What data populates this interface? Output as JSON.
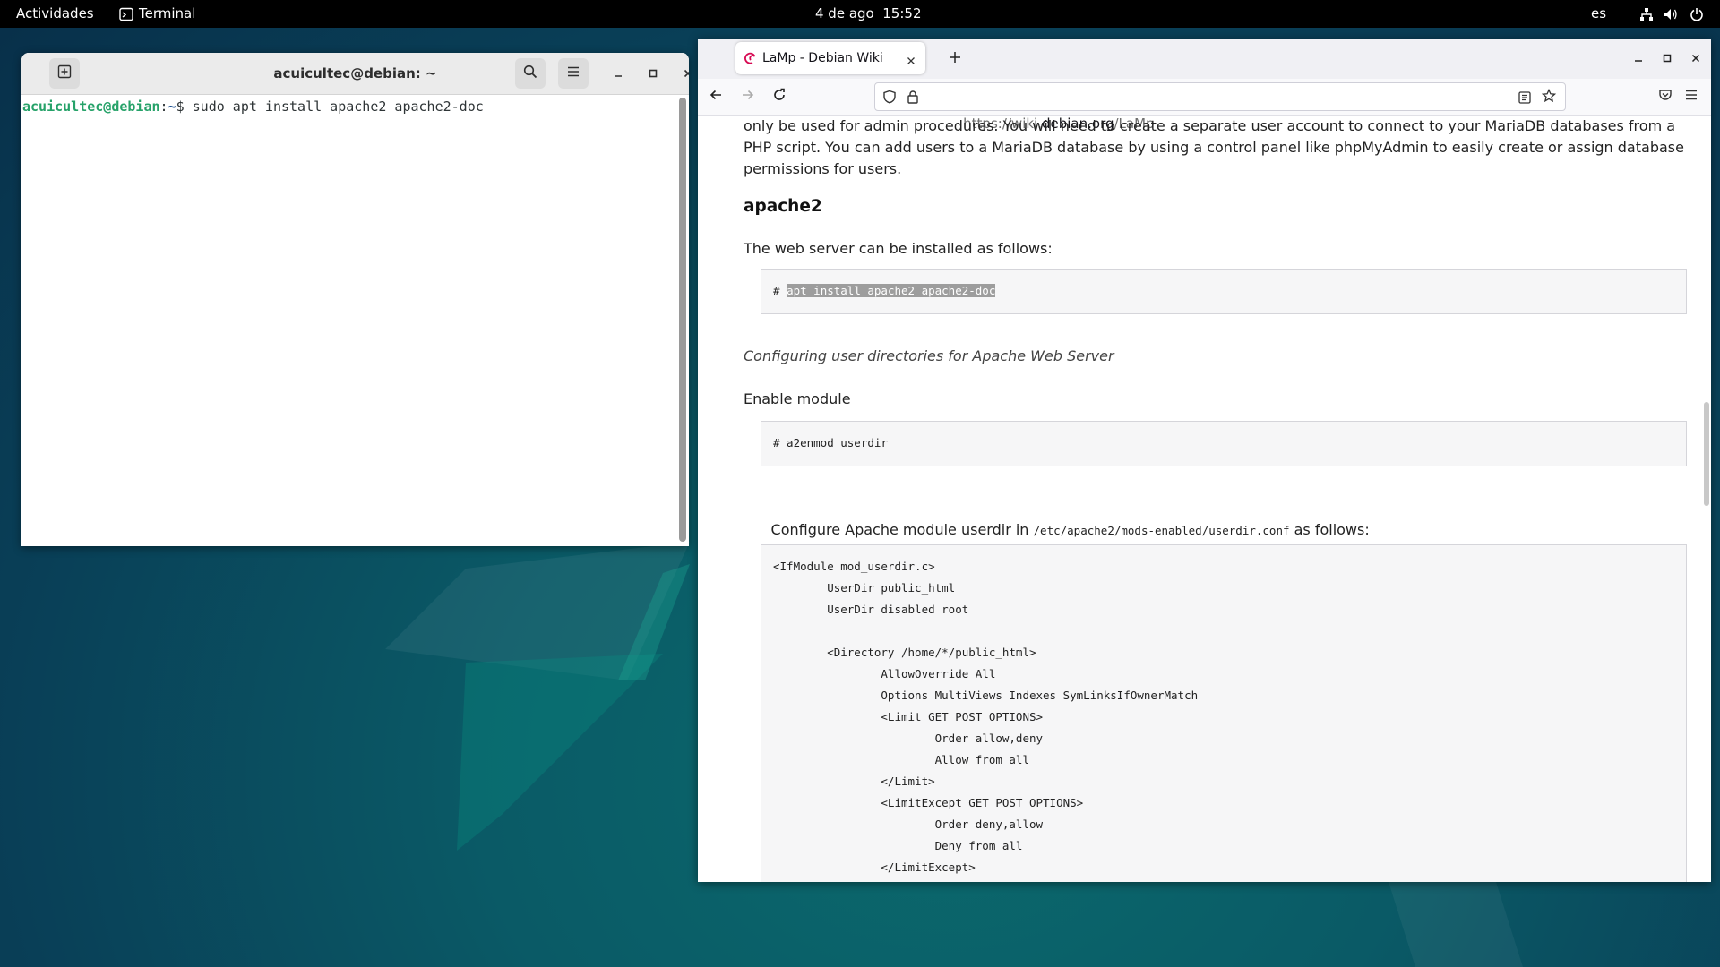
{
  "topbar": {
    "activities": "Actividades",
    "app_name": "Terminal",
    "clock": "4 de ago  15:52",
    "keyboard_layout": "es",
    "icons": [
      "network-icon",
      "volume-icon",
      "power-icon"
    ]
  },
  "terminal": {
    "title": "acuicultec@debian: ~",
    "prompt_user": "acuicultec@debian",
    "prompt_sep": ":",
    "prompt_path": "~",
    "prompt_symbol": "$",
    "command": " sudo apt install apache2 apache2-doc"
  },
  "browser": {
    "tab_title": "LaMp - Debian Wiki",
    "url_prefix": "https://wiki.",
    "url_domain": "debian.org",
    "url_path": "/LaMp",
    "content": {
      "intro_line1": "only be used for admin procedures. You will need to create a separate user account to connect to your MariaDB databases from a",
      "intro_line2": "PHP script. You can add users to a MariaDB database by using a control panel like phpMyAdmin to easily create or assign database",
      "intro_line3": "permissions for users.",
      "heading": "apache2",
      "install_text": "The web server can be installed as follows:",
      "install_code_hash": "# ",
      "install_code_cmd": "apt install apache2 apache2-doc",
      "userdir_heading": "Configuring user directories for Apache Web Server",
      "enable_module": "Enable module",
      "enable_code": "# a2enmod userdir",
      "configure_prefix": "Configure Apache module userdir in ",
      "configure_path": "/etc/apache2/mods-enabled/userdir.conf",
      "configure_suffix": " as follows:",
      "config_lines": [
        "<IfModule mod_userdir.c>",
        "        UserDir public_html",
        "        UserDir disabled root",
        "",
        "        <Directory /home/*/public_html>",
        "                AllowOverride All",
        "                Options MultiViews Indexes SymLinksIfOwnerMatch",
        "                <Limit GET POST OPTIONS>",
        "                        Order allow,deny",
        "                        Allow from all",
        "                </Limit>",
        "                <LimitExcept GET POST OPTIONS>",
        "                        Order deny,allow",
        "                        Deny from all",
        "                </LimitExcept>"
      ]
    }
  }
}
